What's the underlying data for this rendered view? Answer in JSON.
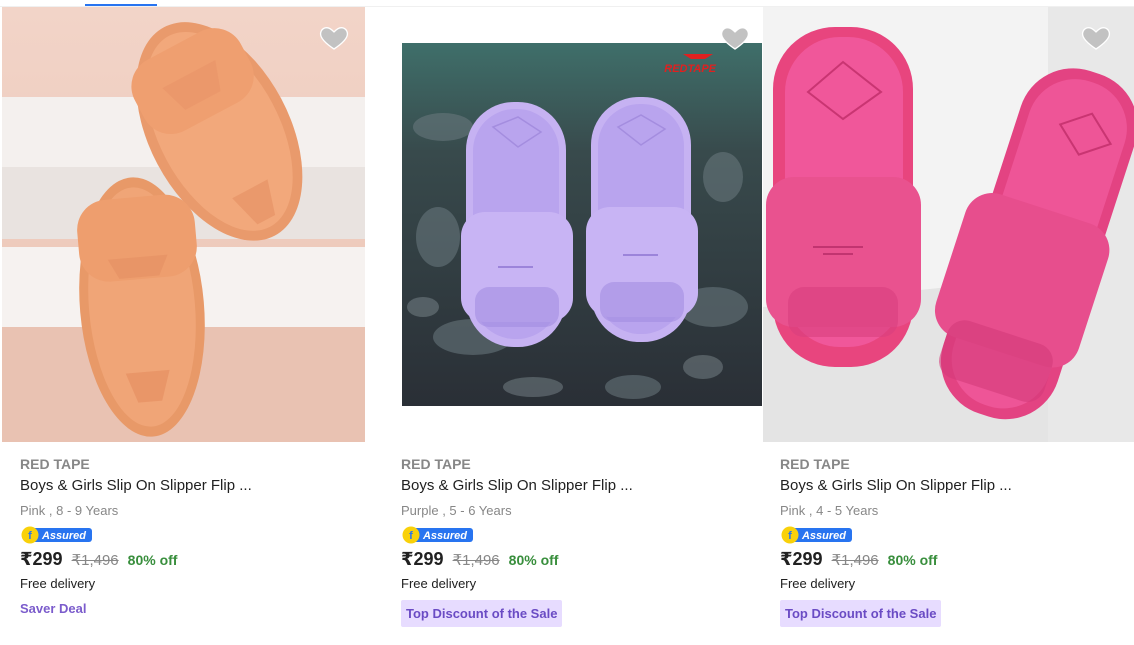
{
  "colors": {
    "accent": "#2874f0",
    "discount_green": "#388e3c",
    "muted_text": "#878787",
    "deal_purple": "#7b5ccc",
    "deal_bg": "#e7dcff"
  },
  "products": [
    {
      "brand": "RED TAPE",
      "title": "Boys & Girls Slip On Slipper Flip ...",
      "variant": "Pink , 8 - 9 Years",
      "assured_label": "Assured",
      "price": "₹299",
      "mrp": "₹1,496",
      "discount": "80% off",
      "delivery": "Free delivery",
      "deal": "Saver Deal",
      "deal_style": "text",
      "image": "orange-slides-photo"
    },
    {
      "brand": "RED TAPE",
      "title": "Boys & Girls Slip On Slipper Flip ...",
      "variant": "Purple , 5 - 6 Years",
      "assured_label": "Assured",
      "price": "₹299",
      "mrp": "₹1,496",
      "discount": "80% off",
      "delivery": "Free delivery",
      "deal": "Top Discount of the Sale",
      "deal_style": "badge",
      "image": "purple-slides-photo",
      "image_logo_text": "REDTAPE"
    },
    {
      "brand": "RED TAPE",
      "title": "Boys & Girls Slip On Slipper Flip ...",
      "variant": "Pink , 4 - 5 Years",
      "assured_label": "Assured",
      "price": "₹299",
      "mrp": "₹1,496",
      "discount": "80% off",
      "delivery": "Free delivery",
      "deal": "Top Discount of the Sale",
      "deal_style": "badge",
      "image": "pink-slides-photo"
    }
  ]
}
